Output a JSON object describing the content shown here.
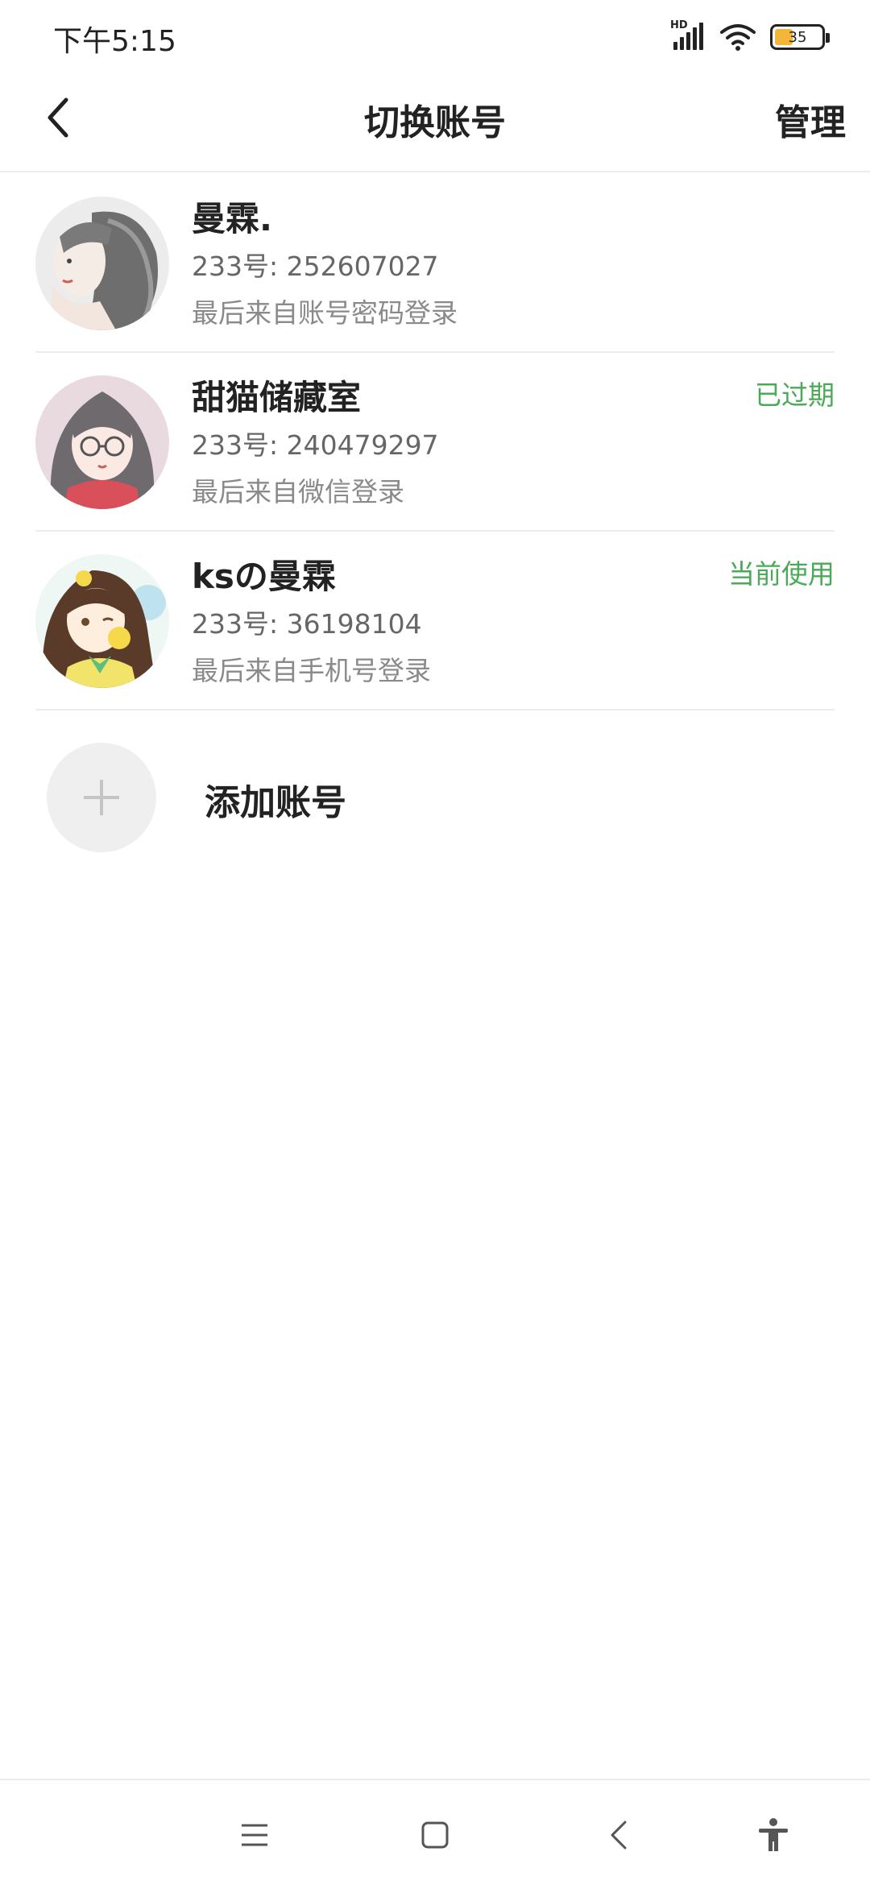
{
  "status_bar": {
    "time": "下午5:15",
    "signal_label": "HD",
    "battery_level": "35",
    "battery_color": "#f4b63a"
  },
  "header": {
    "back_icon": "chevron-left-icon",
    "title": "切换账号",
    "manage_label": "管理"
  },
  "accounts": [
    {
      "name": "曼霖.",
      "id_text": "233号: 252607027",
      "login_method": "最后来自账号密码登录",
      "status": ""
    },
    {
      "name": "甜猫储藏室",
      "id_text": "233号: 240479297",
      "login_method": "最后来自微信登录",
      "status": "已过期"
    },
    {
      "name": "ksの曼霖",
      "id_text": "233号: 36198104",
      "login_method": "最后来自手机号登录",
      "status": "当前使用"
    }
  ],
  "add_account": {
    "label": "添加账号",
    "icon": "plus-icon"
  },
  "nav_bar": {
    "icons": [
      "menu-icon",
      "home-square-icon",
      "back-triangle-icon",
      "accessibility-icon"
    ]
  },
  "colors": {
    "status_green": "#4aaa58",
    "divider": "#ececec"
  }
}
